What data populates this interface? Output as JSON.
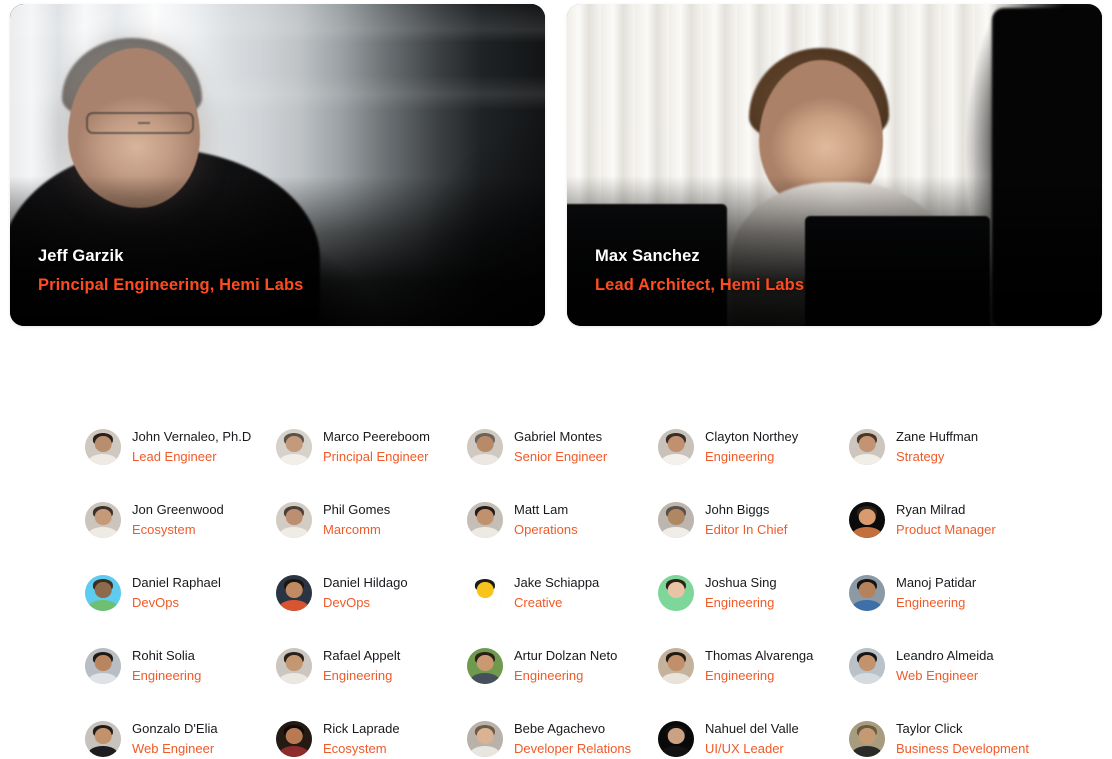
{
  "theme": {
    "background": "#ffffff",
    "accent": "#f05a28",
    "hero_accent": "#ff4b1f",
    "name_color": "#17191c"
  },
  "hero": {
    "cards": [
      {
        "name": "Jeff Garzik",
        "role": "Principal Engineering, Hemi Labs",
        "photo_alt": "jeff-garzik-portrait"
      },
      {
        "name": "Max Sanchez",
        "role": "Lead Architect, Hemi Labs",
        "photo_alt": "max-sanchez-portrait"
      }
    ]
  },
  "team": {
    "members": [
      {
        "name": "John Vernaleo, Ph.D",
        "role": "Lead Engineer",
        "avatar": {
          "bg": "#cfc8c0",
          "skin": "#b98e6f",
          "hair": "#2b2019",
          "shirt": "#efeae3"
        }
      },
      {
        "name": "Marco Peereboom",
        "role": "Principal Engineer",
        "avatar": {
          "bg": "#d6d1ca",
          "skin": "#c49a7c",
          "hair": "#5d5247",
          "shirt": "#f2efe9"
        }
      },
      {
        "name": "Gabriel Montes",
        "role": "Senior Engineer",
        "avatar": {
          "bg": "#cfc9c2",
          "skin": "#b98a68",
          "hair": "#6b625a",
          "shirt": "#ece7e0"
        }
      },
      {
        "name": "Clayton Northey",
        "role": "Engineering",
        "avatar": {
          "bg": "#c9c2ba",
          "skin": "#c1906f",
          "hair": "#3a2d23",
          "shirt": "#f4f1ec"
        }
      },
      {
        "name": "Zane Huffman",
        "role": "Strategy",
        "avatar": {
          "bg": "#cdc6be",
          "skin": "#c29474",
          "hair": "#4a3527",
          "shirt": "#f1ede7"
        }
      },
      {
        "name": "Jon Greenwood",
        "role": "Ecosystem",
        "avatar": {
          "bg": "#cbc5be",
          "skin": "#c59a79",
          "hair": "#3d3027",
          "shirt": "#eeebe5"
        }
      },
      {
        "name": "Phil Gomes",
        "role": "Marcomm",
        "avatar": {
          "bg": "#d2ccc5",
          "skin": "#bb8f70",
          "hair": "#4b4038",
          "shirt": "#efece6"
        }
      },
      {
        "name": "Matt Lam",
        "role": "Operations",
        "avatar": {
          "bg": "#c4beb6",
          "skin": "#c1916e",
          "hair": "#241c16",
          "shirt": "#edeae4"
        }
      },
      {
        "name": "John Biggs",
        "role": "Editor In Chief",
        "avatar": {
          "bg": "#bdb6ae",
          "skin": "#b08763",
          "hair": "#5a5049",
          "shirt": "#f0ede8"
        }
      },
      {
        "name": "Ryan Milrad",
        "role": "Product Manager",
        "avatar": {
          "bg": "#0b0b0c",
          "skin": "#d99a6e",
          "hair": "#2c1f16",
          "shirt": "#c4703e"
        }
      },
      {
        "name": "Daniel Raphael",
        "role": "DevOps",
        "avatar": {
          "bg": "#5ecbf0",
          "skin": "#8e6a4c",
          "hair": "#3f2d1f",
          "shirt": "#6fbf72"
        }
      },
      {
        "name": "Daniel Hildago",
        "role": "DevOps",
        "avatar": {
          "bg": "#2a3442",
          "skin": "#c08a63",
          "hair": "#1b140f",
          "shirt": "#d9552f"
        }
      },
      {
        "name": "Jake Schiappa",
        "role": "Creative",
        "avatar": {
          "bg": "#ffffff",
          "skin": "#f7c41c",
          "hair": "#1b1b1b",
          "shirt": "#ffffff"
        }
      },
      {
        "name": "Joshua Sing",
        "role": "Engineering",
        "avatar": {
          "bg": "#7ed79a",
          "skin": "#e8c4a4",
          "hair": "#2f2119",
          "shirt": "#7ed79a"
        }
      },
      {
        "name": "Manoj Patidar",
        "role": "Engineering",
        "avatar": {
          "bg": "#8c9aa6",
          "skin": "#b5825c",
          "hair": "#171312",
          "shirt": "#3f6fa8"
        }
      },
      {
        "name": "Rohit Solia",
        "role": "Engineering",
        "avatar": {
          "bg": "#b9bec4",
          "skin": "#b8855f",
          "hair": "#201a16",
          "shirt": "#dfe3e8"
        }
      },
      {
        "name": "Rafael Appelt",
        "role": "Engineering",
        "avatar": {
          "bg": "#cbc6bf",
          "skin": "#c29771",
          "hair": "#2a2119",
          "shirt": "#ebe7e1"
        }
      },
      {
        "name": "Artur Dolzan Neto",
        "role": "Engineering",
        "avatar": {
          "bg": "#6f9a4d",
          "skin": "#c99a72",
          "hair": "#2b1f16",
          "shirt": "#46505c"
        }
      },
      {
        "name": "Thomas Alvarenga",
        "role": "Engineering",
        "avatar": {
          "bg": "#c5b29c",
          "skin": "#c1906a",
          "hair": "#241a13",
          "shirt": "#e9e3db"
        }
      },
      {
        "name": "Leandro Almeida",
        "role": "Web Engineer",
        "avatar": {
          "bg": "#b9c2c9",
          "skin": "#c2936c",
          "hair": "#1b1512",
          "shirt": "#d6dbe0"
        }
      },
      {
        "name": "Gonzalo D'Elia",
        "role": "Web Engineer",
        "avatar": {
          "bg": "#c7c2bb",
          "skin": "#c2926c",
          "hair": "#241c16",
          "shirt": "#1d1d20"
        }
      },
      {
        "name": "Rick Laprade",
        "role": "Ecosystem",
        "avatar": {
          "bg": "#241a14",
          "skin": "#b87a52",
          "hair": "#0e0a07",
          "shirt": "#8d2c2c"
        }
      },
      {
        "name": "Bebe Agachevo",
        "role": "Developer Relations",
        "avatar": {
          "bg": "#b9b2ab",
          "skin": "#dbb294",
          "hair": "#6d5a45",
          "shirt": "#e9e5df"
        }
      },
      {
        "name": "Nahuel del Valle",
        "role": "UI/UX Leader",
        "avatar": {
          "bg": "#090909",
          "skin": "#caa183",
          "hair": "#131010",
          "shirt": "#121212"
        }
      },
      {
        "name": "Taylor Click",
        "role": "Business Development",
        "avatar": {
          "bg": "#a89c7e",
          "skin": "#c59a72",
          "hair": "#6a5c42",
          "shirt": "#2b2a28"
        }
      }
    ]
  }
}
